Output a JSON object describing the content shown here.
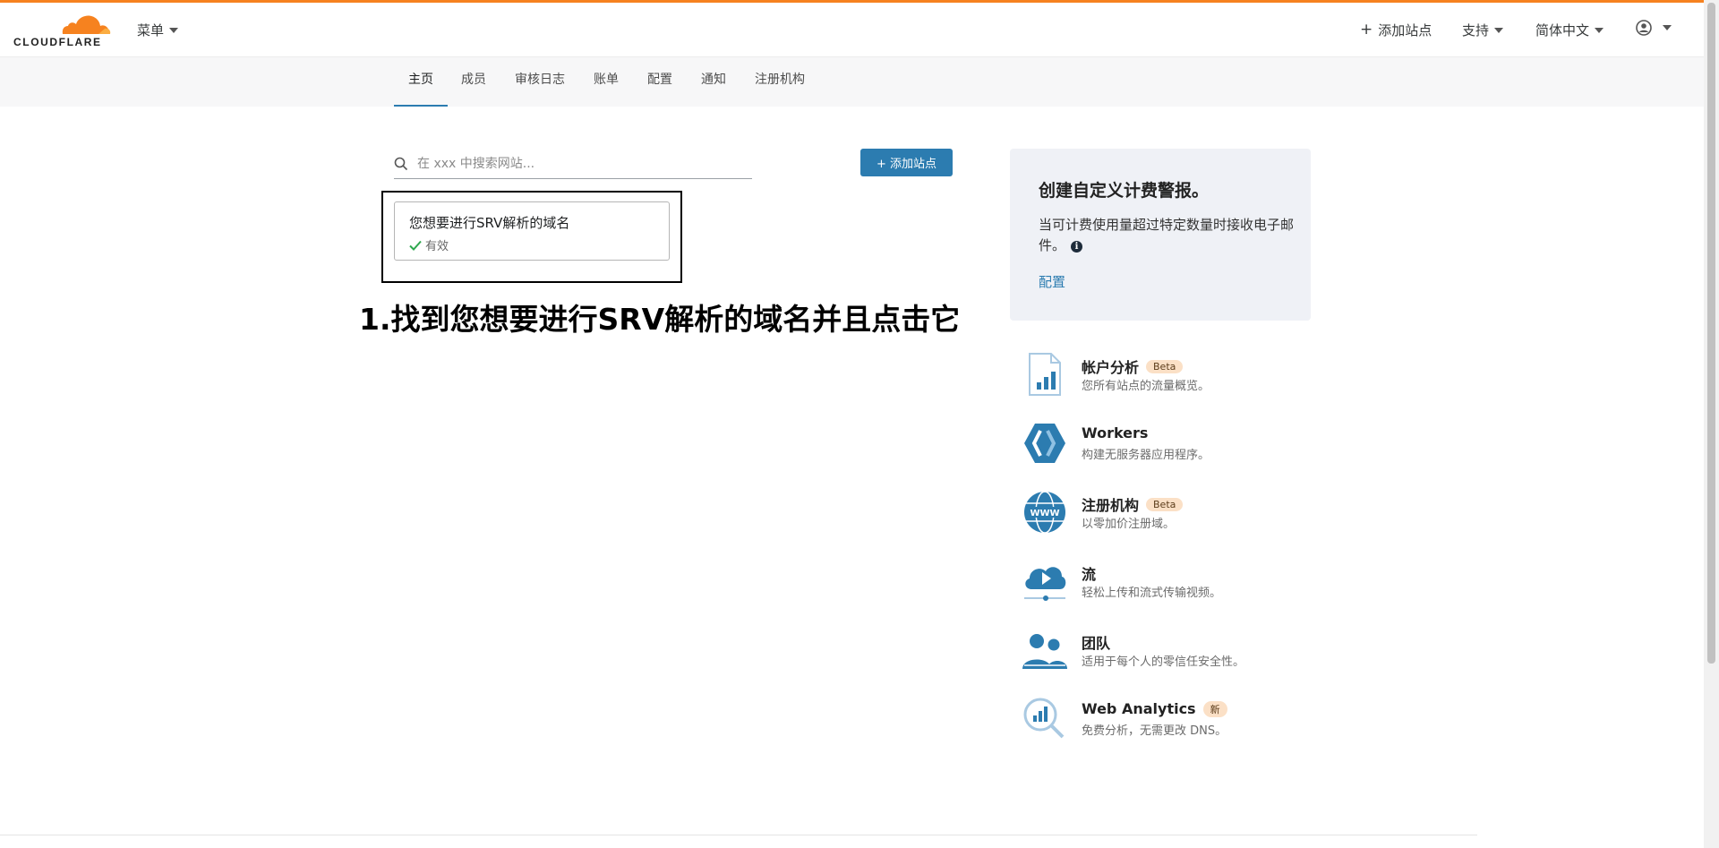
{
  "header": {
    "logo_text": "CLOUDFLARE",
    "menu_label": "菜单",
    "add_site_label": "添加站点",
    "support_label": "支持",
    "language_label": "简体中文"
  },
  "nav": {
    "tabs": [
      {
        "label": "主页"
      },
      {
        "label": "成员"
      },
      {
        "label": "审核日志"
      },
      {
        "label": "账单"
      },
      {
        "label": "配置"
      },
      {
        "label": "通知"
      },
      {
        "label": "注册机构"
      }
    ]
  },
  "search": {
    "placeholder": "在 xxx 中搜索网站..."
  },
  "add_site_button": "+ 添加站点",
  "site": {
    "name": "您想要进行SRV解析的域名",
    "status": "有效"
  },
  "instruction": "1.找到您想要进行SRV解析的域名并且点击它",
  "promo": {
    "title": "创建自定义计费警报。",
    "text": "当可计费使用量超过特定数量时接收电子邮件。",
    "link": "配置"
  },
  "products": [
    {
      "title": "帐户分析",
      "badge": "Beta",
      "desc": "您所有站点的流量概览。",
      "icon": "analytics-icon"
    },
    {
      "title": "Workers",
      "badge": "",
      "desc": "构建无服务器应用程序。",
      "icon": "workers-icon"
    },
    {
      "title": "注册机构",
      "badge": "Beta",
      "desc": "以零加价注册域。",
      "icon": "globe-www-icon"
    },
    {
      "title": "流",
      "badge": "",
      "desc": "轻松上传和流式传输视频。",
      "icon": "stream-icon"
    },
    {
      "title": "团队",
      "badge": "",
      "desc": "适用于每个人的零信任安全性。",
      "icon": "teams-icon"
    },
    {
      "title": "Web Analytics",
      "badge": "新",
      "desc": "免费分析，无需更改 DNS。",
      "icon": "web-analytics-icon"
    }
  ],
  "colors": {
    "accent": "#2c7cb0",
    "brand_orange": "#f6821f",
    "badge_bg": "#fbe0c6"
  }
}
